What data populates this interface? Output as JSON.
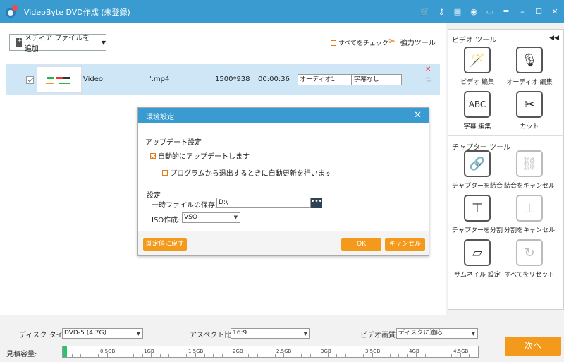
{
  "titlebar": {
    "title": "VideoByte DVD作成 (未登録)",
    "icons": [
      "cart-icon",
      "key-icon",
      "document-icon",
      "chat-icon",
      "feedback-icon",
      "menu-icon",
      "minimize-icon",
      "maximize-icon",
      "close-icon"
    ]
  },
  "toolbar": {
    "add_media": "メディア ファイルを追加",
    "check_all": "すべてをチェック",
    "power_tool": "強力ツール"
  },
  "file": {
    "name": "Video",
    "ext": "'.mp4",
    "resolution": "1500*938",
    "duration": "00:00:36",
    "audio": "オーディオ1",
    "subtitle": "字幕なし"
  },
  "video_tools": {
    "heading": "ビデオ ツール",
    "items": [
      {
        "label": "ビデオ 編集",
        "icon": "magic-wand-icon",
        "enabled": true
      },
      {
        "label": "オーディオ 編集",
        "icon": "microphone-icon",
        "enabled": true
      },
      {
        "label": "字幕 編集",
        "icon": "abc-subtitle-icon",
        "enabled": true
      },
      {
        "label": "カット",
        "icon": "scissors-icon",
        "enabled": true
      }
    ]
  },
  "chapter_tools": {
    "heading": "チャプター ツール",
    "items": [
      {
        "label": "チャプターを結合",
        "icon": "link-icon",
        "enabled": true
      },
      {
        "label": "結合をキャンセル",
        "icon": "unlink-icon",
        "enabled": false
      },
      {
        "label": "チャプターを分割",
        "icon": "split-icon",
        "enabled": true
      },
      {
        "label": "分割をキャンセル",
        "icon": "cancel-split-icon",
        "enabled": false
      },
      {
        "label": "サムネイル 設定",
        "icon": "thumbnail-icon",
        "enabled": true
      },
      {
        "label": "すべてをリセット",
        "icon": "reset-icon",
        "enabled": false
      }
    ]
  },
  "dialog": {
    "title": "環境設定",
    "update_section": "アップデート設定",
    "auto_update": "自動的にアップデートします",
    "auto_update_checked": true,
    "update_on_exit": "プログラムから退出するときに自動更新を行います",
    "update_on_exit_checked": false,
    "settings_section": "設定",
    "temp_path_label": "一時ファイルの保存先:",
    "temp_path_value": "D:\\",
    "browse_label": "•••",
    "iso_label": "ISO作成:",
    "iso_value": "VSO",
    "restore_defaults": "既定値に戻す",
    "ok": "OK",
    "cancel": "キャンセル"
  },
  "bottom": {
    "disc_type_label": "ディスク タイプ",
    "disc_type_value": "DVD-5 (4.7G)",
    "aspect_label": "アスペクト比:",
    "aspect_value": "16:9",
    "quality_label": "ビデオ画質:",
    "quality_value": "ディスクに適応",
    "capacity_label": "見積容量:",
    "capacity_fraction": 0.01,
    "capacity_ticks": [
      "0.5GB",
      "1GB",
      "1.5GB",
      "2GB",
      "2.5GB",
      "3GB",
      "3.5GB",
      "4GB",
      "4.5GB"
    ],
    "next": "次へ"
  },
  "colors": {
    "accent": "#3a9bd0",
    "button": "#f39a1c",
    "selection": "#cfe6f6",
    "capacity": "#2ec36a"
  }
}
